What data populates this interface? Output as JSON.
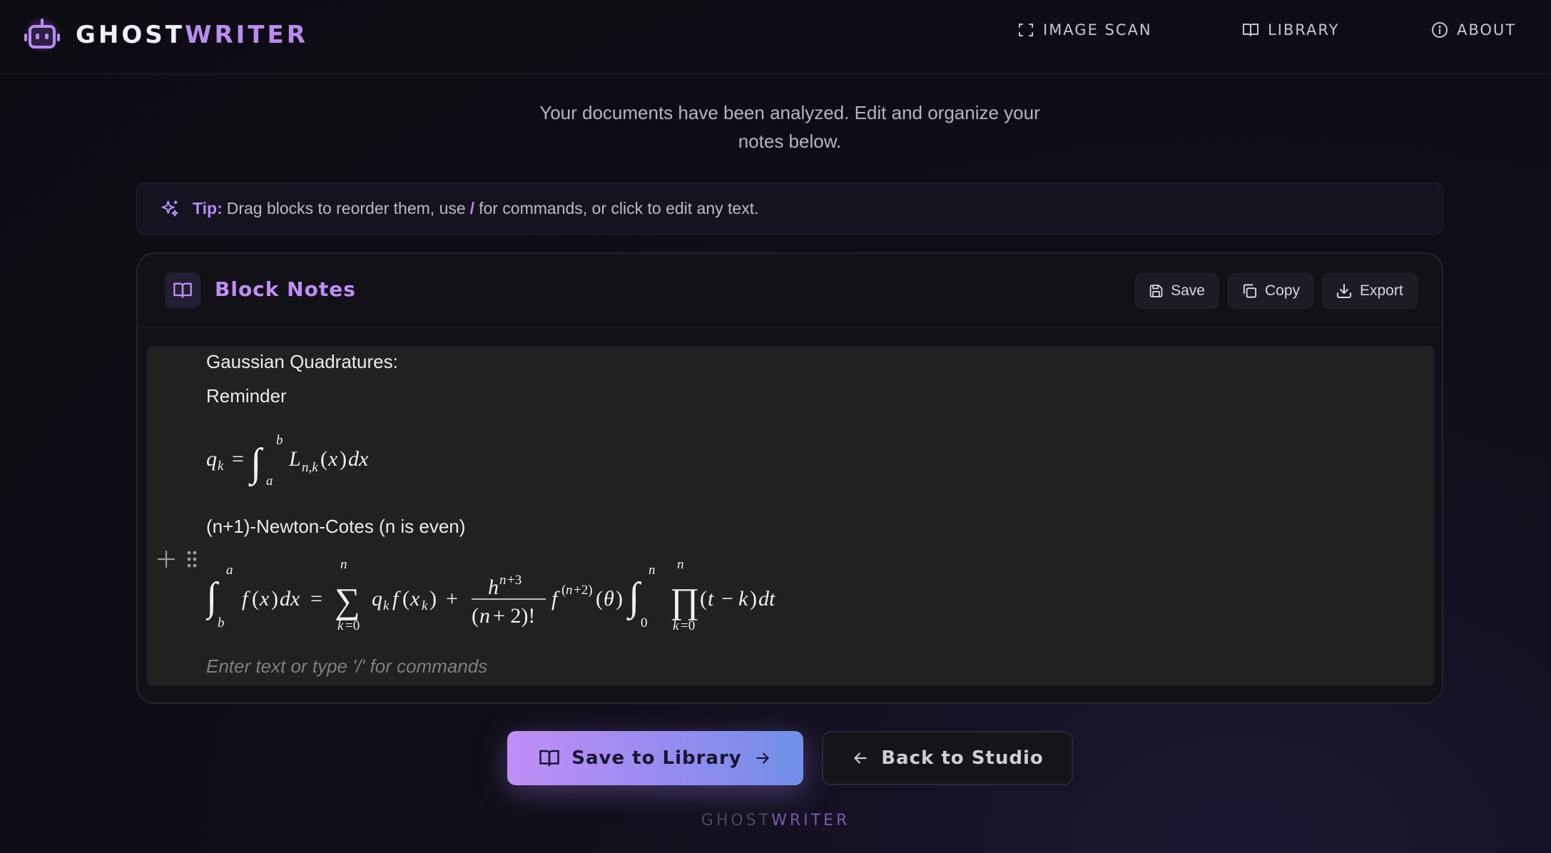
{
  "app": {
    "brand_prefix": "GHOST",
    "brand_suffix": "WRITER",
    "accent_color": "#b98cf2"
  },
  "nav": {
    "items": [
      {
        "label": "IMAGE SCAN",
        "icon": "scan-icon"
      },
      {
        "label": "LIBRARY",
        "icon": "book-icon"
      },
      {
        "label": "ABOUT",
        "icon": "info-icon"
      }
    ]
  },
  "subtitle": {
    "line1": "Your documents have been analyzed. Edit and organize your",
    "line2": "notes below."
  },
  "tip": {
    "label": "Tip:",
    "text_before": "Drag blocks to reorder them, use",
    "slash": "/",
    "text_after": "for commands, or click to edit any text."
  },
  "editor": {
    "title": "Block Notes",
    "actions": {
      "save": "Save",
      "copy": "Copy",
      "export": "Export"
    },
    "blocks": [
      "Gaussian Quadratures:",
      "Reminder",
      "(n+1)-Newton-Cotes (n is even)"
    ],
    "placeholder": "Enter text or type '/' for commands"
  },
  "buttons": {
    "save_library": "Save to Library",
    "back_studio": "Back to Studio"
  },
  "footer": {
    "prefix": "GHOST",
    "suffix": "WRITER"
  }
}
